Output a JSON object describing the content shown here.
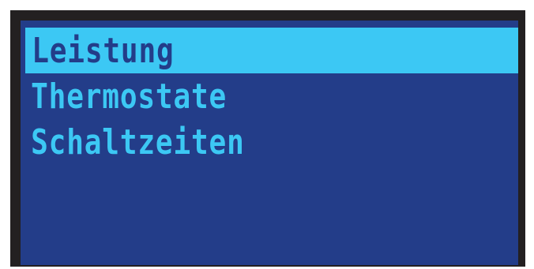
{
  "display": {
    "colors": {
      "bezel": "#232021",
      "background": "#233d89",
      "text": "#3cc8f4",
      "highlight": "#3cc8f4",
      "highlight_text": "#233d89"
    },
    "menu": {
      "selected_index": 0,
      "items": [
        {
          "label": "Leistung"
        },
        {
          "label": "Thermostate"
        },
        {
          "label": "Schaltzeiten"
        }
      ]
    }
  }
}
